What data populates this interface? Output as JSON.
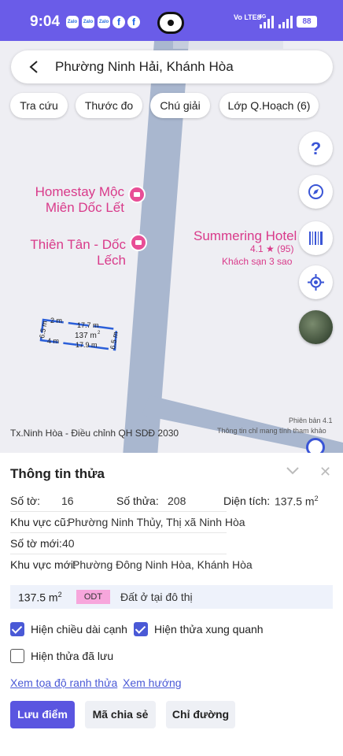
{
  "status_bar": {
    "time": "9:04",
    "notification_icons": [
      "Zalo",
      "Zalo",
      "Zalo",
      "f",
      "f"
    ],
    "network_label": "Vo LTE8",
    "signal_label": "4G",
    "battery": "88"
  },
  "search": {
    "location": "Phường Ninh Hải, Khánh Hòa"
  },
  "toolbar": {
    "chips": [
      "Tra cứu",
      "Thước đo",
      "Chú giải",
      "Lớp Q.Hoạch (6)"
    ]
  },
  "map": {
    "pois": [
      {
        "name_line1": "Homestay Mộc",
        "name_line2": "Miên Dốc Lết"
      },
      {
        "name": "Thiên Tân - Dốc Lếch"
      },
      {
        "name": "Summering Hotel",
        "rating": "4.1 ★ (95)",
        "category": "Khách sạn 3 sao"
      }
    ],
    "parcel": {
      "area": "137",
      "area_unit": "m",
      "dimensions": [
        "17.7 m",
        "17.9 m",
        "6.5 m",
        "6.5 m",
        "2 m",
        "4 m"
      ]
    },
    "fab_help": "?",
    "footer_left": "Tx.Ninh Hòa - Điều chỉnh QH SDĐ 2030",
    "version": "Phiên bản 4.1",
    "credit": "Thông tin chỉ mang tính tham khảo"
  },
  "sheet": {
    "title": "Thông tin thửa",
    "so_to_label": "Số tờ:",
    "so_to_value": "16",
    "so_thua_label": "Số thửa:",
    "so_thua_value": "208",
    "dien_tich_label": "Diện tích:",
    "dien_tich_value": "137.5 m",
    "unit_sup": "2",
    "khu_vuc_cu_label": "Khu vực cũ:",
    "khu_vuc_cu_value": "Phường Ninh Thủy, Thị xã Ninh Hòa",
    "so_to_moi_label": "Số tờ mới:",
    "so_to_moi_value": "40",
    "khu_vuc_moi_label": "Khu vực mới:",
    "khu_vuc_moi_value": "Phường Đông Ninh Hòa, Khánh Hòa",
    "summary_area": "137.5 m",
    "summary_code": "ODT",
    "summary_desc": "Đất ở tại đô thị",
    "checkboxes": [
      {
        "label": "Hiện chiều dài cạnh",
        "checked": true
      },
      {
        "label": "Hiện thửa xung quanh",
        "checked": true
      },
      {
        "label": "Hiện thửa đã lưu",
        "checked": false
      }
    ],
    "links": [
      "Xem tọa độ ranh thửa",
      "Xem hướng"
    ],
    "buttons": [
      "Lưu điểm",
      "Mã chia sẻ",
      "Chỉ đường"
    ]
  },
  "colors": {
    "status_bar": "#6a5ce8",
    "accent": "#4a59d6",
    "poi": "#d93a8a",
    "road": "#a9b7cf",
    "map_bg": "#eeeef3"
  }
}
